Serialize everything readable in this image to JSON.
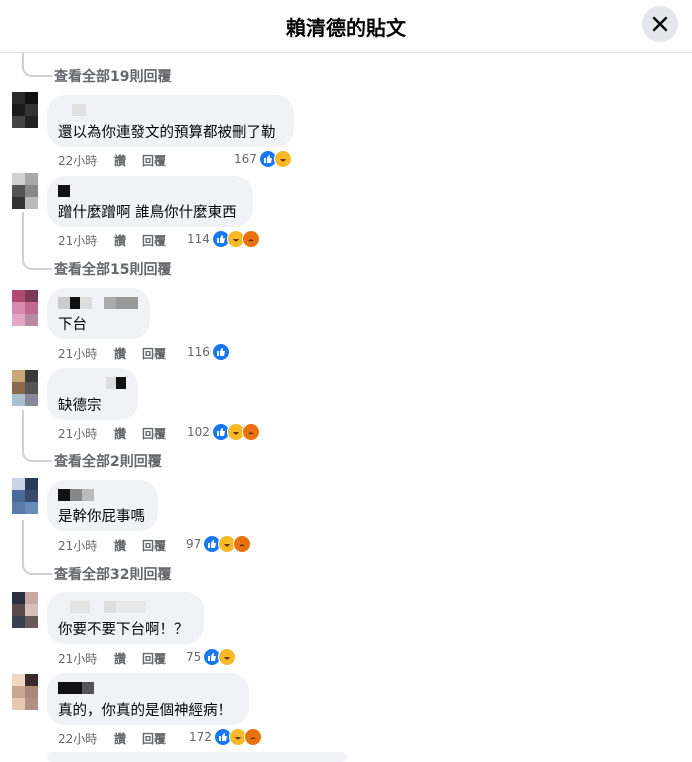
{
  "header": {
    "title": "賴清德的貼文",
    "close_label": "✕"
  },
  "actions": {
    "like": "讚",
    "reply": "回覆"
  },
  "view_more": [
    "查看全部19則回覆",
    "查看全部15則回覆",
    "查看全部2則回覆",
    "查看全部32則回覆"
  ],
  "comments": [
    {
      "text": "還以為你連發文的預算都被刪了勒",
      "time": "22小時",
      "count": "167",
      "reactions": [
        "like",
        "haha"
      ]
    },
    {
      "text": "蹭什麼蹭啊 誰鳥你什麼東西",
      "time": "21小時",
      "count": "114",
      "reactions": [
        "like",
        "haha",
        "angry"
      ]
    },
    {
      "text": "下台",
      "time": "21小時",
      "count": "116",
      "reactions": [
        "like"
      ]
    },
    {
      "text": "缺德宗",
      "time": "21小時",
      "count": "102",
      "reactions": [
        "like",
        "haha",
        "angry"
      ]
    },
    {
      "text": "是幹你屁事嗎",
      "time": "21小時",
      "count": "97",
      "reactions": [
        "like",
        "haha",
        "angry"
      ]
    },
    {
      "text": "你要不要下台啊！？",
      "time": "21小時",
      "count": "75",
      "reactions": [
        "like",
        "haha"
      ]
    },
    {
      "text": "真的，你真的是個神經病！",
      "time": "22小時",
      "count": "172",
      "reactions": [
        "like",
        "haha",
        "angry"
      ]
    }
  ],
  "colors": {
    "accent": "#1877f2",
    "meta": "#65676b",
    "bubble": "#f0f2f5",
    "haha": "#f7b928",
    "angry": "#e9710f"
  }
}
